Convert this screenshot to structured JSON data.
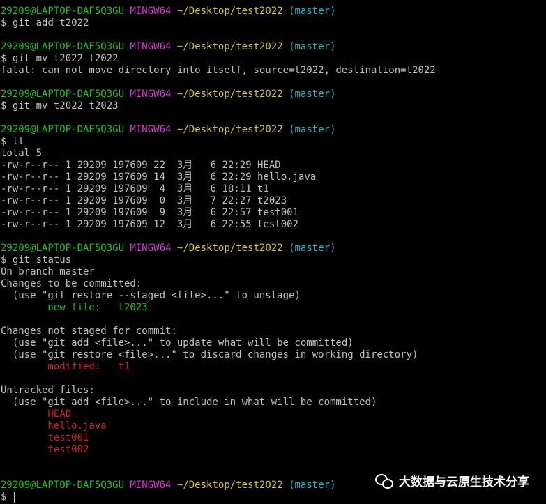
{
  "prompt": {
    "user_host": "29209@LAPTOP-DAF5Q3GU",
    "system": "MINGW64",
    "path": "~/Desktop/test2022",
    "branch": "(master)",
    "symbol": "$"
  },
  "commands": {
    "add": "git add t2022",
    "mv1": "git mv t2022 t2022",
    "mv1_error": "fatal: can not move directory into itself, source=t2022, destination=t2022",
    "mv2": "git mv t2022 t2023",
    "ll": "ll",
    "status": "git status"
  },
  "listing": {
    "total": "total 5",
    "rows": [
      "-rw-r--r-- 1 29209 197609 22  3月   6 22:29 HEAD",
      "-rw-r--r-- 1 29209 197609 14  3月   6 22:29 hello.java",
      "-rw-r--r-- 1 29209 197609  4  3月   6 18:11 t1",
      "-rw-r--r-- 1 29209 197609  0  3月   7 22:27 t2023",
      "-rw-r--r-- 1 29209 197609  9  3月   6 22:57 test001",
      "-rw-r--r-- 1 29209 197609 12  3月   6 22:55 test002"
    ]
  },
  "status": {
    "on_branch": "On branch master",
    "staged_header": "Changes to be committed:",
    "staged_hint": "  (use \"git restore --staged <file>...\" to unstage)",
    "staged_item": "        new file:   t2023",
    "unstaged_header": "Changes not staged for commit:",
    "unstaged_hint1": "  (use \"git add <file>...\" to update what will be committed)",
    "unstaged_hint2": "  (use \"git restore <file>...\" to discard changes in working directory)",
    "unstaged_item": "        modified:   t1",
    "untracked_header": "Untracked files:",
    "untracked_hint": "  (use \"git add <file>...\" to include in what will be committed)",
    "untracked_items": [
      "        HEAD",
      "        hello.java",
      "        test001",
      "        test002"
    ]
  },
  "watermark": {
    "text": "大数据与云原生技术分享",
    "icon": "wechat-icon"
  },
  "colors": {
    "background": "#000000",
    "text": "#c0c0c0",
    "user_host": "#1fc11f",
    "system": "#d43fd4",
    "path": "#d4c14a",
    "branch": "#29b6c9",
    "staged": "#1fc11f",
    "unstaged": "#d42020"
  }
}
